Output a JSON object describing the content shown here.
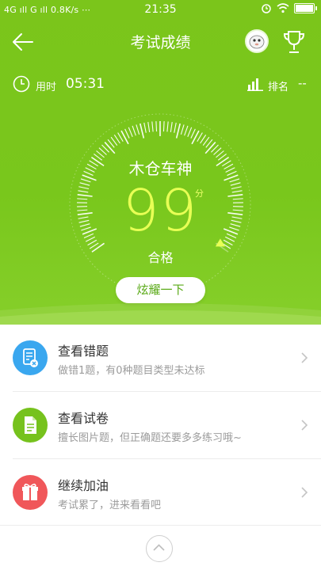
{
  "status_bar": {
    "left": "4G ıll G ıll 0.8K/s  ⋯",
    "time": "21:35"
  },
  "nav": {
    "title": "考试成绩"
  },
  "stats": {
    "time_label": "用时",
    "time_value": "05:31",
    "rank_label": "排名",
    "rank_value": "--"
  },
  "result": {
    "title": "木仓车神",
    "score": "99",
    "unit": "分",
    "grade": "合格",
    "share_button": "炫耀一下",
    "gauge_fraction": 0.99
  },
  "menu": [
    {
      "title": "查看错题",
      "subtitle": "做错1题，有0种题目类型未达标",
      "icon": "wrong-questions-icon",
      "color": "#3aa7ef"
    },
    {
      "title": "查看试卷",
      "subtitle": "擅长图片题，但正确题还要多多练习哦~",
      "icon": "document-icon",
      "color": "#76c21d"
    },
    {
      "title": "继续加油",
      "subtitle": "考试累了，进来看看吧",
      "icon": "gift-icon",
      "color": "#f0575a"
    }
  ],
  "colors": {
    "hero_green": "#79c71c",
    "score_yellow": "#e8ff55"
  }
}
